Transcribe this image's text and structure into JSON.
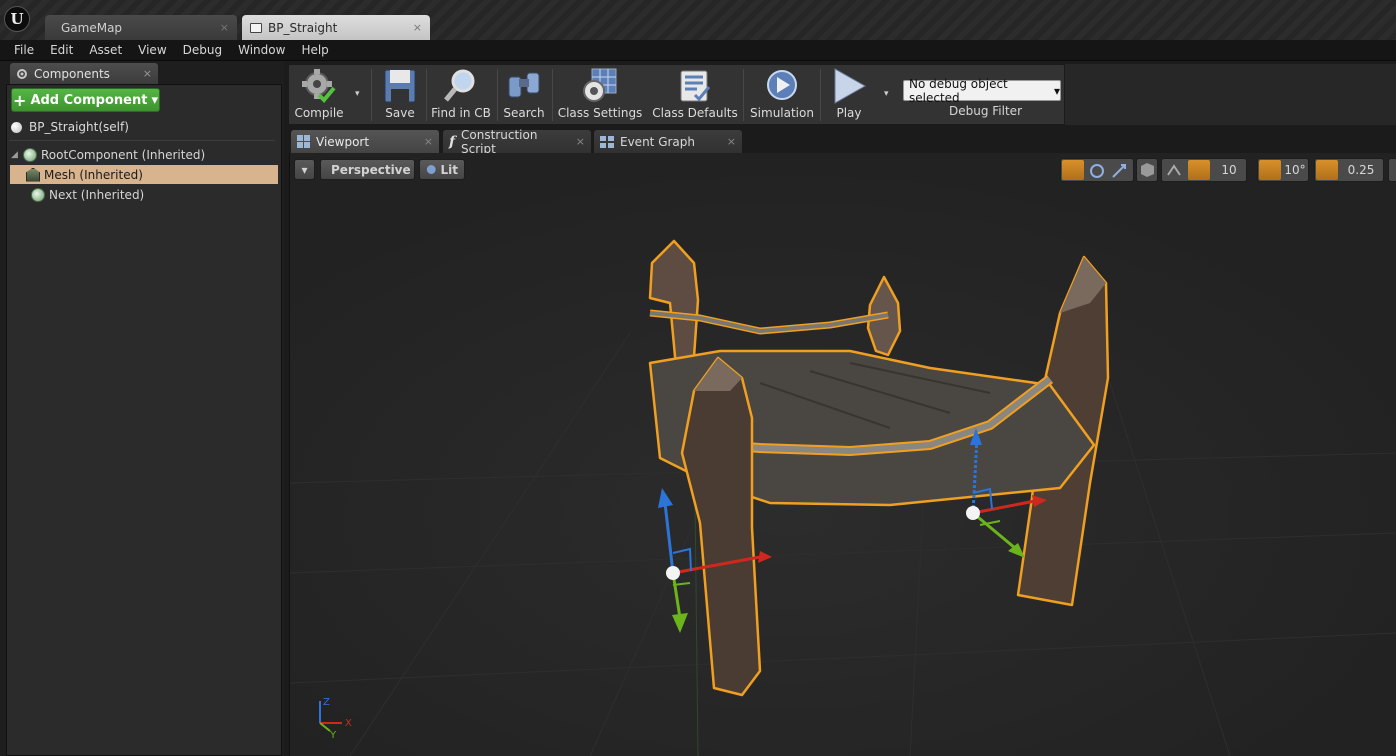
{
  "window": {
    "logo_text": "U",
    "doc_tabs": [
      {
        "label": "GameMap",
        "close": "×"
      },
      {
        "label": "BP_Straight",
        "close": "×"
      }
    ]
  },
  "menu": [
    "File",
    "Edit",
    "Asset",
    "View",
    "Debug",
    "Window",
    "Help"
  ],
  "components_panel": {
    "tab_label": "Components",
    "tab_close": "×",
    "add_button_label": "Add Component",
    "add_button_plus": "+",
    "add_button_arrow": "▾",
    "self_label": "BP_Straight(self)",
    "tree": [
      {
        "label": "RootComponent (Inherited)",
        "expander": "◢"
      },
      {
        "label": "Mesh (Inherited)"
      },
      {
        "label": "Next (Inherited)"
      }
    ]
  },
  "toolbar": {
    "buttons": [
      {
        "label": "Compile",
        "icon": "compile-gear-icon"
      },
      {
        "label": "Save",
        "icon": "save-disk-icon"
      },
      {
        "label": "Find in CB",
        "icon": "magnifier-icon"
      },
      {
        "label": "Search",
        "icon": "binoculars-icon"
      },
      {
        "label": "Class Settings",
        "icon": "gear-grid-icon"
      },
      {
        "label": "Class Defaults",
        "icon": "checklist-icon"
      },
      {
        "label": "Simulation",
        "icon": "simulation-icon"
      },
      {
        "label": "Play",
        "icon": "play-icon"
      }
    ],
    "dropdown_arrow": "▾",
    "debug_select_value": "No debug object selected",
    "debug_filter_label": "Debug Filter"
  },
  "editor_tabs": [
    {
      "label": "Viewport",
      "close": "×",
      "icon": "viewport-grid-icon"
    },
    {
      "label": "Construction Script",
      "close": "×",
      "icon": "function-icon",
      "glyph": "f"
    },
    {
      "label": "Event Graph",
      "close": "×",
      "icon": "event-graph-icon"
    }
  ],
  "viewport": {
    "menu_arrow": "▾",
    "perspective_label": "Perspective",
    "lit_label": "Lit",
    "grid_snap": "10",
    "rotation_snap": "10°",
    "scale_snap": "0.25",
    "axis_labels": {
      "x": "X",
      "y": "Y",
      "z": "Z"
    },
    "colors": {
      "selection_outline": "#f0a020",
      "x_axis": "#d0281c",
      "y_axis": "#6cb41c",
      "z_axis": "#2c74d8",
      "background": "#262626"
    }
  }
}
